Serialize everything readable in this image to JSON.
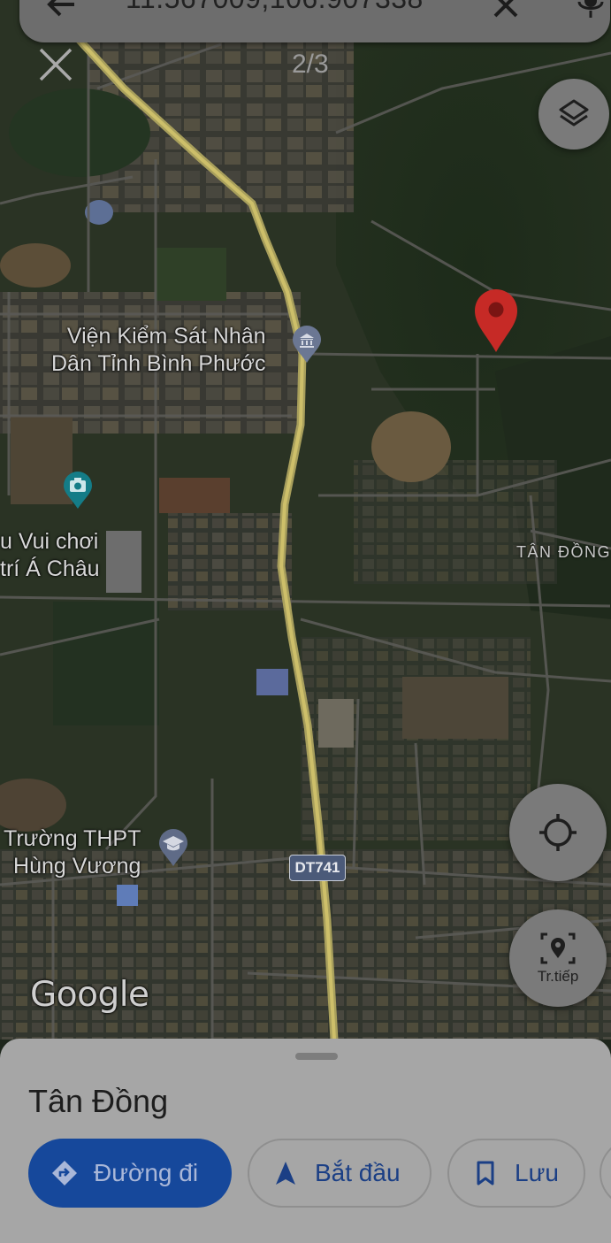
{
  "search": {
    "query": "11.567009,106.907338"
  },
  "nav": {
    "photo_counter": "2/3"
  },
  "map": {
    "labels": {
      "procuracy_line1": "Viện Kiểm Sát Nhân",
      "procuracy_line2": "Dân Tỉnh Bình Phước",
      "park_line1": "u Vui chơi",
      "park_line2": "trí Á Châu",
      "school_line1": "Trường THPT",
      "school_line2": "Hùng Vương",
      "area": "TÂN ĐỒNG"
    },
    "road_shield": "DT741",
    "attribution": "Google",
    "pin_color": "#c62a26"
  },
  "controls": {
    "live_view_label": "Tr.tiếp"
  },
  "sheet": {
    "place_name": "Tân Đồng",
    "directions_label": "Đường đi",
    "start_label": "Bắt đầu",
    "save_label": "Lưu"
  },
  "colors": {
    "primary_button": "#16489b",
    "accent_text": "#1b3f85",
    "main_road": "#cdbf6a"
  }
}
